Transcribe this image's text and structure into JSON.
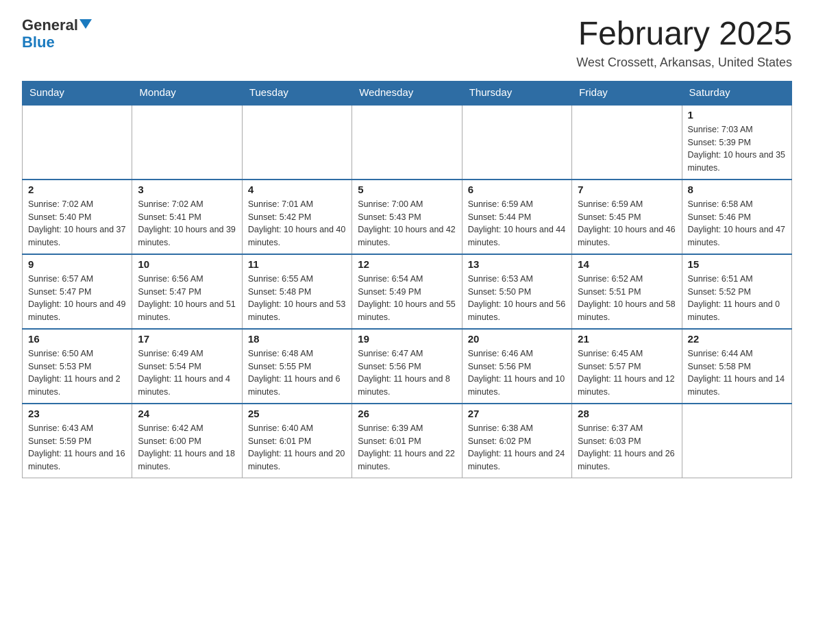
{
  "header": {
    "logo_general": "General",
    "logo_blue": "Blue",
    "month_title": "February 2025",
    "location": "West Crossett, Arkansas, United States"
  },
  "days_of_week": [
    "Sunday",
    "Monday",
    "Tuesday",
    "Wednesday",
    "Thursday",
    "Friday",
    "Saturday"
  ],
  "weeks": [
    [
      {
        "day": "",
        "info": ""
      },
      {
        "day": "",
        "info": ""
      },
      {
        "day": "",
        "info": ""
      },
      {
        "day": "",
        "info": ""
      },
      {
        "day": "",
        "info": ""
      },
      {
        "day": "",
        "info": ""
      },
      {
        "day": "1",
        "info": "Sunrise: 7:03 AM\nSunset: 5:39 PM\nDaylight: 10 hours and 35 minutes."
      }
    ],
    [
      {
        "day": "2",
        "info": "Sunrise: 7:02 AM\nSunset: 5:40 PM\nDaylight: 10 hours and 37 minutes."
      },
      {
        "day": "3",
        "info": "Sunrise: 7:02 AM\nSunset: 5:41 PM\nDaylight: 10 hours and 39 minutes."
      },
      {
        "day": "4",
        "info": "Sunrise: 7:01 AM\nSunset: 5:42 PM\nDaylight: 10 hours and 40 minutes."
      },
      {
        "day": "5",
        "info": "Sunrise: 7:00 AM\nSunset: 5:43 PM\nDaylight: 10 hours and 42 minutes."
      },
      {
        "day": "6",
        "info": "Sunrise: 6:59 AM\nSunset: 5:44 PM\nDaylight: 10 hours and 44 minutes."
      },
      {
        "day": "7",
        "info": "Sunrise: 6:59 AM\nSunset: 5:45 PM\nDaylight: 10 hours and 46 minutes."
      },
      {
        "day": "8",
        "info": "Sunrise: 6:58 AM\nSunset: 5:46 PM\nDaylight: 10 hours and 47 minutes."
      }
    ],
    [
      {
        "day": "9",
        "info": "Sunrise: 6:57 AM\nSunset: 5:47 PM\nDaylight: 10 hours and 49 minutes."
      },
      {
        "day": "10",
        "info": "Sunrise: 6:56 AM\nSunset: 5:47 PM\nDaylight: 10 hours and 51 minutes."
      },
      {
        "day": "11",
        "info": "Sunrise: 6:55 AM\nSunset: 5:48 PM\nDaylight: 10 hours and 53 minutes."
      },
      {
        "day": "12",
        "info": "Sunrise: 6:54 AM\nSunset: 5:49 PM\nDaylight: 10 hours and 55 minutes."
      },
      {
        "day": "13",
        "info": "Sunrise: 6:53 AM\nSunset: 5:50 PM\nDaylight: 10 hours and 56 minutes."
      },
      {
        "day": "14",
        "info": "Sunrise: 6:52 AM\nSunset: 5:51 PM\nDaylight: 10 hours and 58 minutes."
      },
      {
        "day": "15",
        "info": "Sunrise: 6:51 AM\nSunset: 5:52 PM\nDaylight: 11 hours and 0 minutes."
      }
    ],
    [
      {
        "day": "16",
        "info": "Sunrise: 6:50 AM\nSunset: 5:53 PM\nDaylight: 11 hours and 2 minutes."
      },
      {
        "day": "17",
        "info": "Sunrise: 6:49 AM\nSunset: 5:54 PM\nDaylight: 11 hours and 4 minutes."
      },
      {
        "day": "18",
        "info": "Sunrise: 6:48 AM\nSunset: 5:55 PM\nDaylight: 11 hours and 6 minutes."
      },
      {
        "day": "19",
        "info": "Sunrise: 6:47 AM\nSunset: 5:56 PM\nDaylight: 11 hours and 8 minutes."
      },
      {
        "day": "20",
        "info": "Sunrise: 6:46 AM\nSunset: 5:56 PM\nDaylight: 11 hours and 10 minutes."
      },
      {
        "day": "21",
        "info": "Sunrise: 6:45 AM\nSunset: 5:57 PM\nDaylight: 11 hours and 12 minutes."
      },
      {
        "day": "22",
        "info": "Sunrise: 6:44 AM\nSunset: 5:58 PM\nDaylight: 11 hours and 14 minutes."
      }
    ],
    [
      {
        "day": "23",
        "info": "Sunrise: 6:43 AM\nSunset: 5:59 PM\nDaylight: 11 hours and 16 minutes."
      },
      {
        "day": "24",
        "info": "Sunrise: 6:42 AM\nSunset: 6:00 PM\nDaylight: 11 hours and 18 minutes."
      },
      {
        "day": "25",
        "info": "Sunrise: 6:40 AM\nSunset: 6:01 PM\nDaylight: 11 hours and 20 minutes."
      },
      {
        "day": "26",
        "info": "Sunrise: 6:39 AM\nSunset: 6:01 PM\nDaylight: 11 hours and 22 minutes."
      },
      {
        "day": "27",
        "info": "Sunrise: 6:38 AM\nSunset: 6:02 PM\nDaylight: 11 hours and 24 minutes."
      },
      {
        "day": "28",
        "info": "Sunrise: 6:37 AM\nSunset: 6:03 PM\nDaylight: 11 hours and 26 minutes."
      },
      {
        "day": "",
        "info": ""
      }
    ]
  ]
}
